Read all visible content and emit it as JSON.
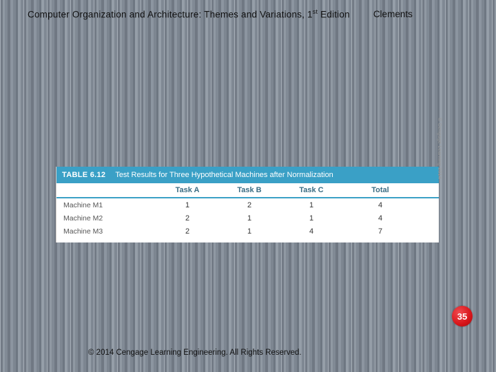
{
  "header": {
    "title_prefix": "Computer Organization and Architecture: Themes and Variations, 1",
    "title_sup": "st",
    "title_suffix": " Edition",
    "author": "Clements"
  },
  "table": {
    "label": "TABLE 6.12",
    "caption": "Test Results for Three Hypothetical Machines after Normalization",
    "columns": {
      "label": "",
      "a": "Task A",
      "b": "Task B",
      "c": "Task C",
      "t": "Total"
    },
    "rows": [
      {
        "label": "Machine M1",
        "a": "1",
        "b": "2",
        "c": "1",
        "t": "4"
      },
      {
        "label": "Machine M2",
        "a": "2",
        "b": "1",
        "c": "1",
        "t": "4"
      },
      {
        "label": "Machine M3",
        "a": "2",
        "b": "1",
        "c": "4",
        "t": "7"
      }
    ],
    "credit": "© Cengage Learning 2014"
  },
  "page_number": "35",
  "footer": "© 2014 Cengage Learning Engineering. All Rights Reserved."
}
